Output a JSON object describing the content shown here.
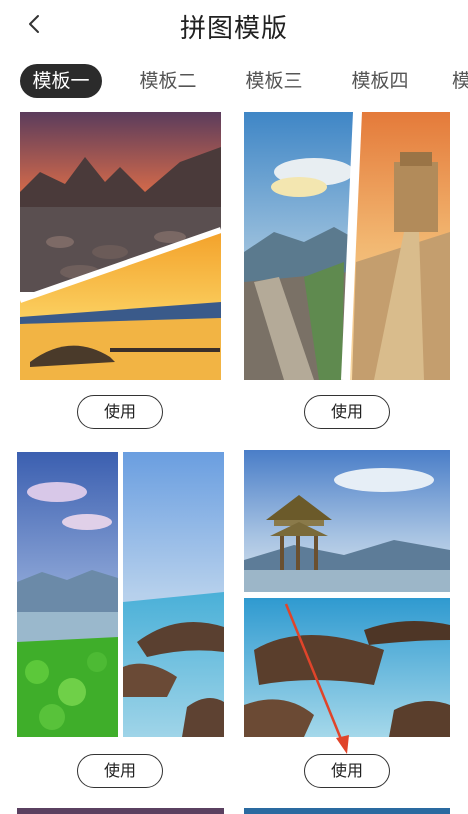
{
  "header": {
    "title": "拼图模版"
  },
  "tabs": [
    "模板一",
    "模板二",
    "模板三",
    "模板四",
    "模"
  ],
  "templates": [
    {
      "use_label": "使用"
    },
    {
      "use_label": "使用"
    },
    {
      "use_label": "使用"
    },
    {
      "use_label": "使用"
    }
  ],
  "colors": {
    "accent": "#2b2b2b",
    "annotation_arrow": "#e0442a"
  }
}
